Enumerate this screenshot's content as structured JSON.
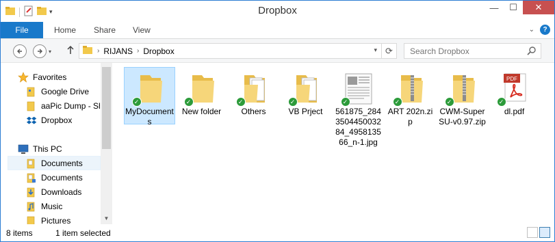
{
  "window": {
    "title": "Dropbox"
  },
  "window_controls": {
    "minimize": "—",
    "maximize": "☐",
    "close": "✕"
  },
  "ribbon": {
    "tabs": [
      {
        "label": "File"
      },
      {
        "label": "Home"
      },
      {
        "label": "Share"
      },
      {
        "label": "View"
      }
    ]
  },
  "address": {
    "crumbs": [
      "RIJANS",
      "Dropbox"
    ],
    "search_placeholder": "Search Dropbox"
  },
  "nav": {
    "favorites_label": "Favorites",
    "favorites": [
      {
        "label": "Google Drive"
      },
      {
        "label": "aaPic Dump - Sh"
      },
      {
        "label": "Dropbox"
      }
    ],
    "thispc_label": "This PC",
    "thispc": [
      {
        "label": "Documents"
      },
      {
        "label": "Documents"
      },
      {
        "label": "Downloads"
      },
      {
        "label": "Music"
      },
      {
        "label": "Pictures"
      }
    ]
  },
  "files": [
    {
      "label": "MyDocuments",
      "type": "folder",
      "selected": true
    },
    {
      "label": "New folder",
      "type": "folder"
    },
    {
      "label": "Others",
      "type": "folder-docs"
    },
    {
      "label": "VB Prject",
      "type": "folder-docs"
    },
    {
      "label": "561875_284350445003284_495813566_n-1.jpg",
      "type": "image"
    },
    {
      "label": "ART 202n.zip",
      "type": "zip"
    },
    {
      "label": "CWM-SuperSU-v0.97.zip",
      "type": "zip"
    },
    {
      "label": "dl.pdf",
      "type": "pdf"
    }
  ],
  "pdf_badge": "PDF",
  "status": {
    "count": "8 items",
    "selection": "1 item selected"
  },
  "colors": {
    "accent": "#1979ca",
    "selected_bg": "#cce8ff",
    "sync_green": "#2c9b3a",
    "folder": "#f2d06b",
    "close": "#c75050"
  }
}
